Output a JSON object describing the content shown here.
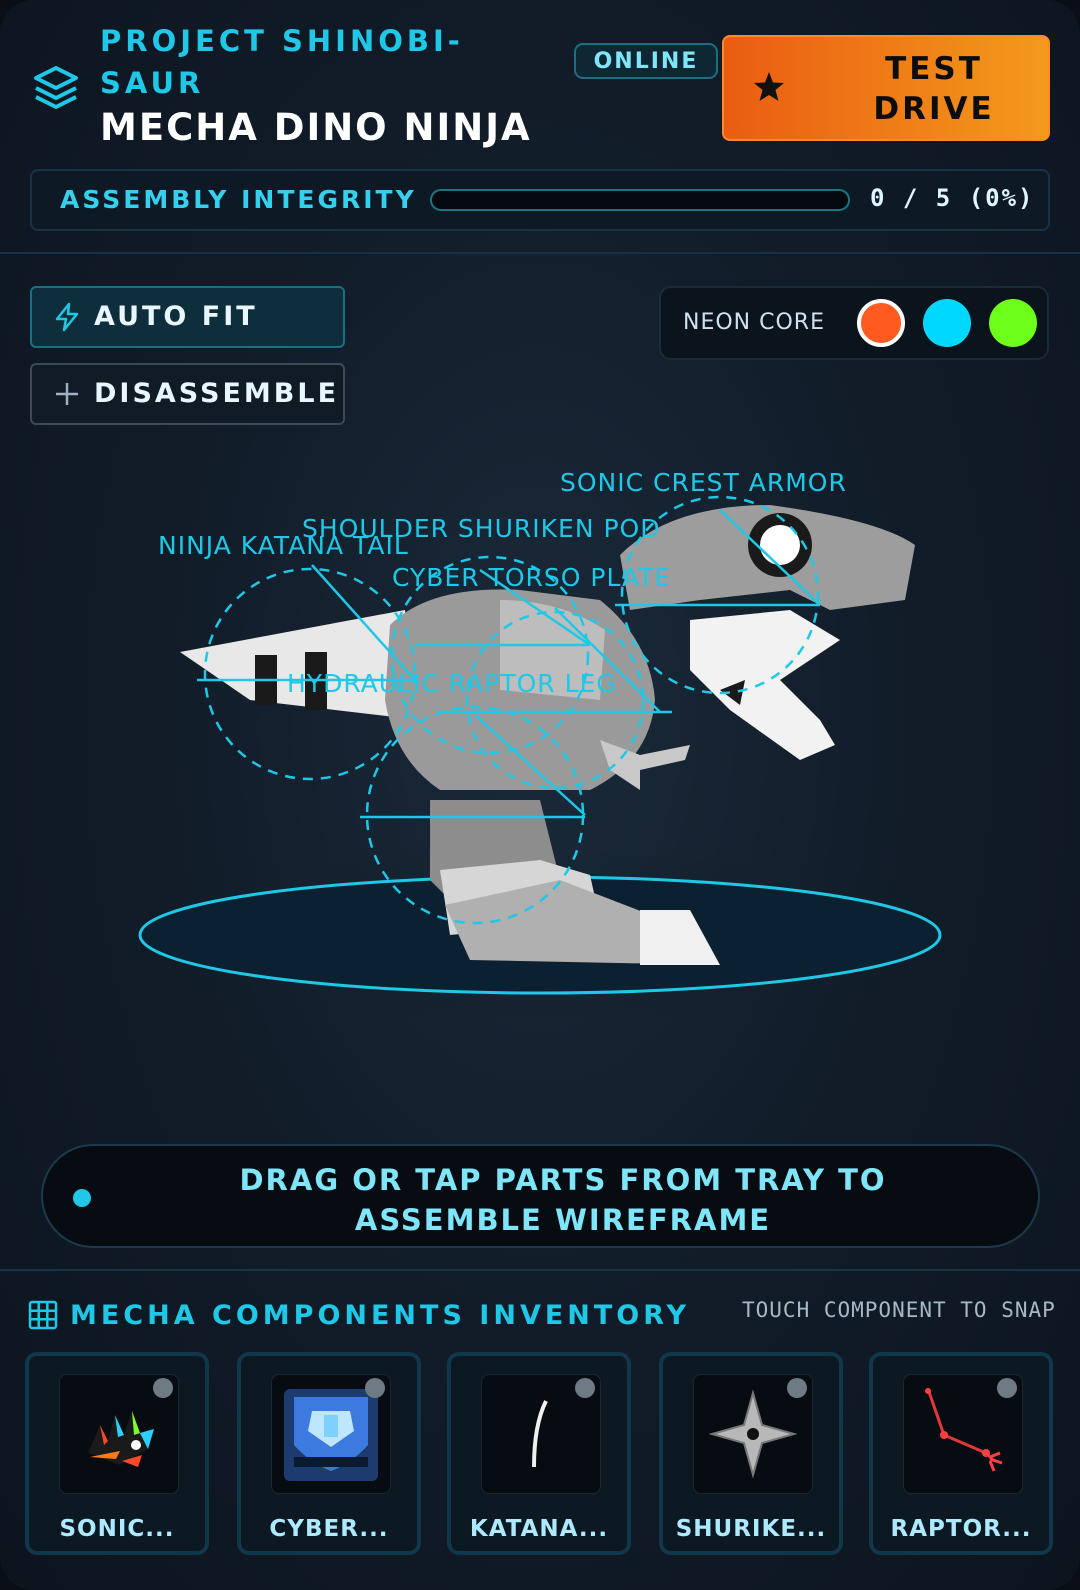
{
  "header": {
    "project": "PROJECT SHINOBI-SAUR",
    "name": "MECHA DINO NINJA",
    "status": "ONLINE",
    "test_drive": "TEST DRIVE"
  },
  "integrity": {
    "label": "ASSEMBLY INTEGRITY",
    "value_text": "0 / 5 (0%)",
    "progress": 0
  },
  "tools": {
    "auto_fit": "AUTO FIT",
    "disassemble": "DISASSEMBLE"
  },
  "neon": {
    "label": "NEON CORE",
    "colors": [
      "#ff5a1f",
      "#00d8ff",
      "#6dff1a"
    ],
    "selected": 0
  },
  "stage": {
    "labels": {
      "crest": "SONIC CREST ARMOR",
      "shoulder": "SHOULDER SHURIKEN POD",
      "tail": "NINJA KATANA TAIL",
      "torso": "CYBER TORSO PLATE",
      "leg": "HYDRAULIC RAPTOR LEG"
    },
    "accent": "#1ec8e6"
  },
  "hint": "DRAG OR TAP PARTS FROM TRAY TO ASSEMBLE WIREFRAME",
  "inventory": {
    "title": "MECHA COMPONENTS INVENTORY",
    "hint": "TOUCH COMPONENT TO SNAP",
    "items": [
      {
        "label": "SONIC...",
        "icon": "sonic-crest-icon"
      },
      {
        "label": "CYBER...",
        "icon": "cyber-torso-icon"
      },
      {
        "label": "KATANA...",
        "icon": "katana-tail-icon"
      },
      {
        "label": "SHURIKE...",
        "icon": "shuriken-icon"
      },
      {
        "label": "RAPTOR...",
        "icon": "raptor-leg-icon"
      }
    ]
  }
}
